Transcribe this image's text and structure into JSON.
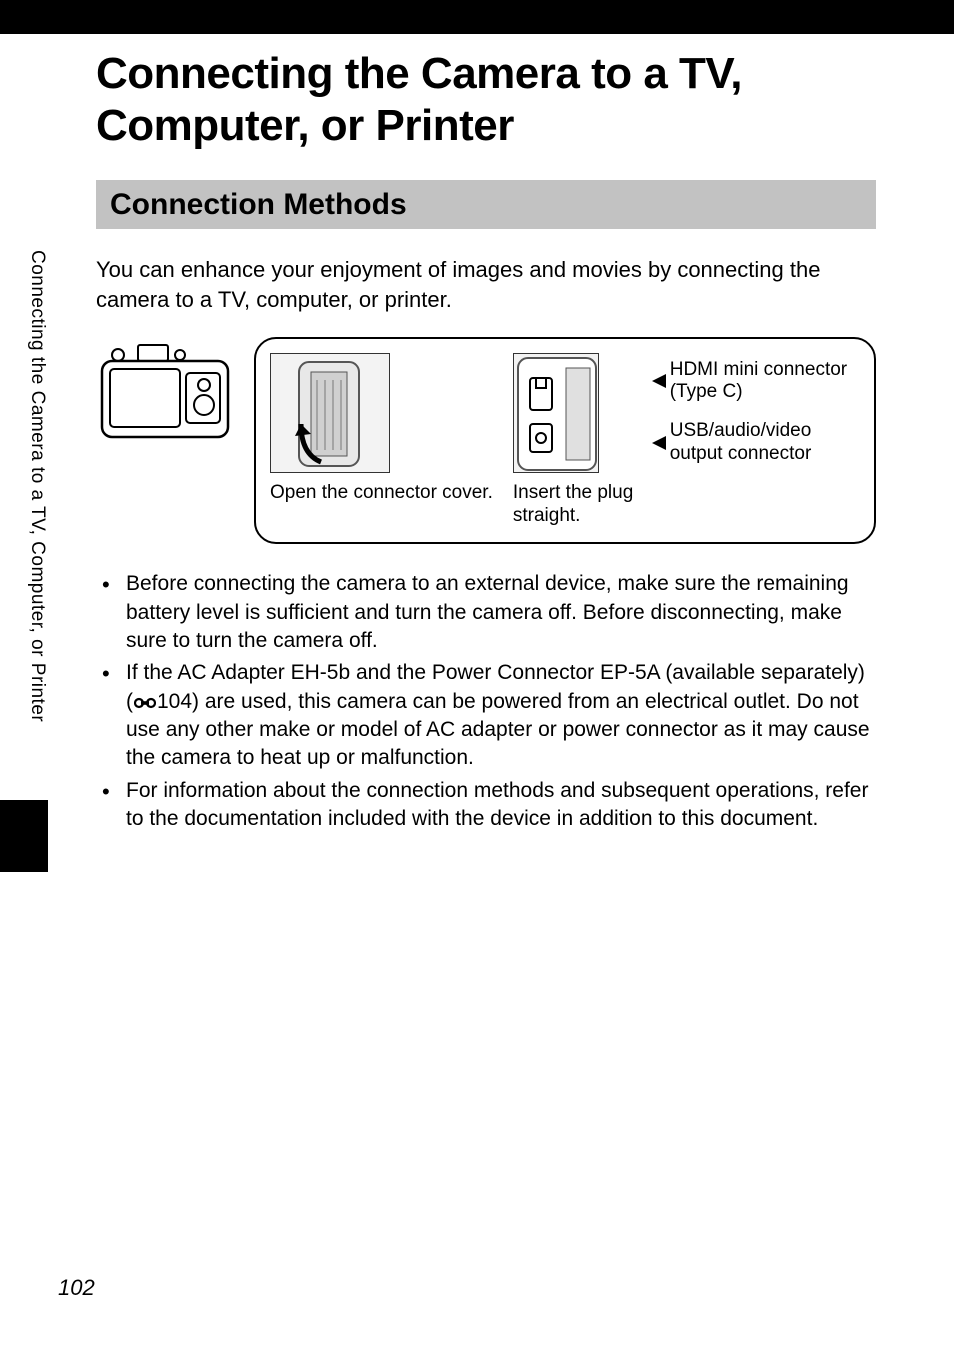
{
  "sideTab": "Connecting the Camera to a TV, Computer, or Printer",
  "title": "Connecting the Camera to a TV, Computer, or Printer",
  "sectionHeader": "Connection Methods",
  "intro": "You can enhance your enjoyment of images and movies by connecting the camera to a TV, computer, or printer.",
  "diagram": {
    "step1Caption": "Open the connector cover.",
    "step2Caption": "Insert the plug straight.",
    "connLabel1": "HDMI mini connector (Type C)",
    "connLabel2": "USB/audio/video output connector"
  },
  "bullets": {
    "b1": "Before connecting the camera to an external device, make sure the remaining battery level is sufficient and turn the camera off. Before disconnecting, make sure to turn the camera off.",
    "b2a": "If the AC Adapter EH-5b and the Power Connector EP-5A (available separately) (",
    "b2ref": "104",
    "b2b": ") are used, this camera can be powered from an electrical outlet. Do not use any other make or model of AC adapter or power connector as it may cause the camera to heat up or malfunction.",
    "b3": "For information about the connection methods and subsequent operations, refer to the documentation included with the device in addition to this document."
  },
  "pageNumber": "102"
}
